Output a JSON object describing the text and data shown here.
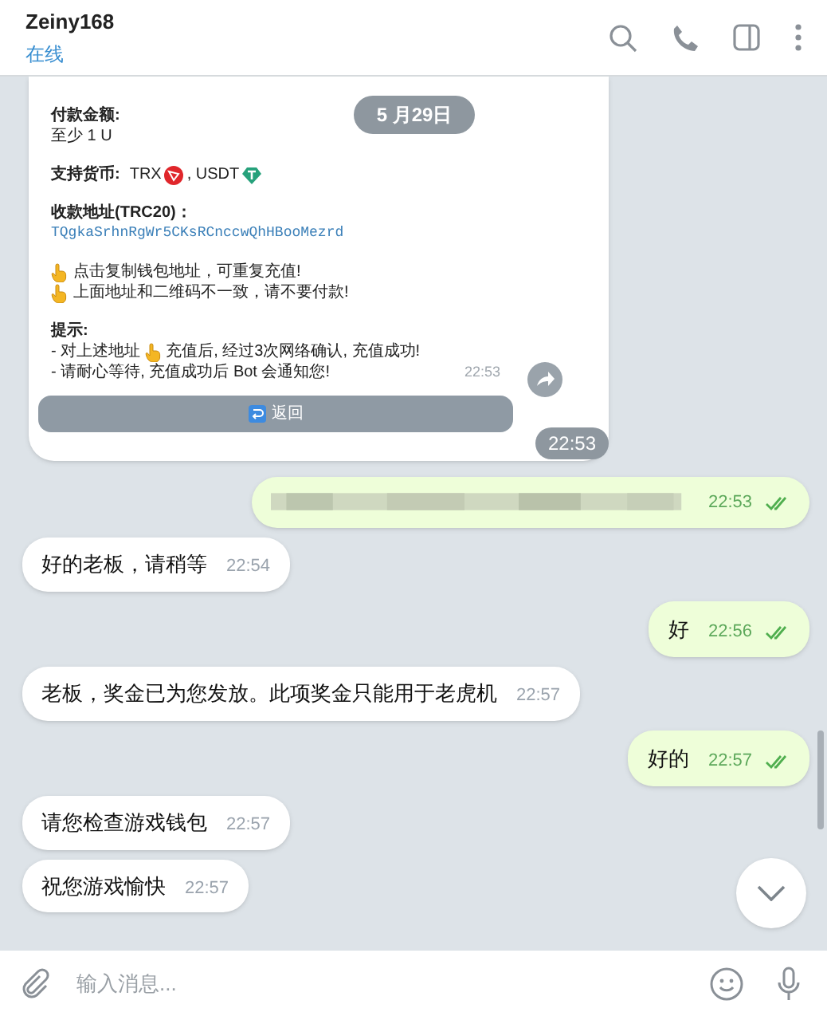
{
  "header": {
    "name": "Zeiny168",
    "status": "在线"
  },
  "bot_card": {
    "amount_label": "付款金额:",
    "amount_value": "至少 1 U",
    "currency_label": "支持货币:",
    "currencies": [
      {
        "text": "TRX",
        "kind": "tron"
      },
      {
        "text": ", USDT",
        "kind": "tether"
      }
    ],
    "address_label": "收款地址(TRC20)：",
    "address": "TQgkaSrhnRgWr5CKsRCnccwQhHBooMezrd",
    "tips": [
      "点击复制钱包地址，可重复充值!",
      "上面地址和二维码不一致，请不要付款!"
    ],
    "notes_title": "提示:",
    "notes": [
      {
        "before": "- 对上述地址",
        "after": "充值后, 经过3次网络确认, 充值成功!"
      },
      {
        "before": "- 请耐心等待, 充值成功后 Bot 会通知您!"
      }
    ],
    "time": "22:53",
    "button": "返回"
  },
  "date_pill": "5 月29日",
  "time_pill": "22:53",
  "messages": [
    {
      "kind": "blurred",
      "time": "22:53",
      "read": true
    },
    {
      "kind": "incoming",
      "text": "好的老板，请稍等",
      "time": "22:54"
    },
    {
      "kind": "outgoing",
      "text": "好",
      "time": "22:56",
      "read": true
    },
    {
      "kind": "incoming",
      "text": "老板，奖金已为您发放。此项奖金只能用于老虎机",
      "time": "22:57"
    },
    {
      "kind": "outgoing",
      "text": "好的",
      "time": "22:57",
      "read": true
    },
    {
      "kind": "incoming",
      "text": "请您检查游戏钱包",
      "time": "22:57"
    },
    {
      "kind": "incoming",
      "text": "祝您游戏愉快",
      "time": "22:57"
    }
  ],
  "composer": {
    "placeholder": "输入消息..."
  }
}
